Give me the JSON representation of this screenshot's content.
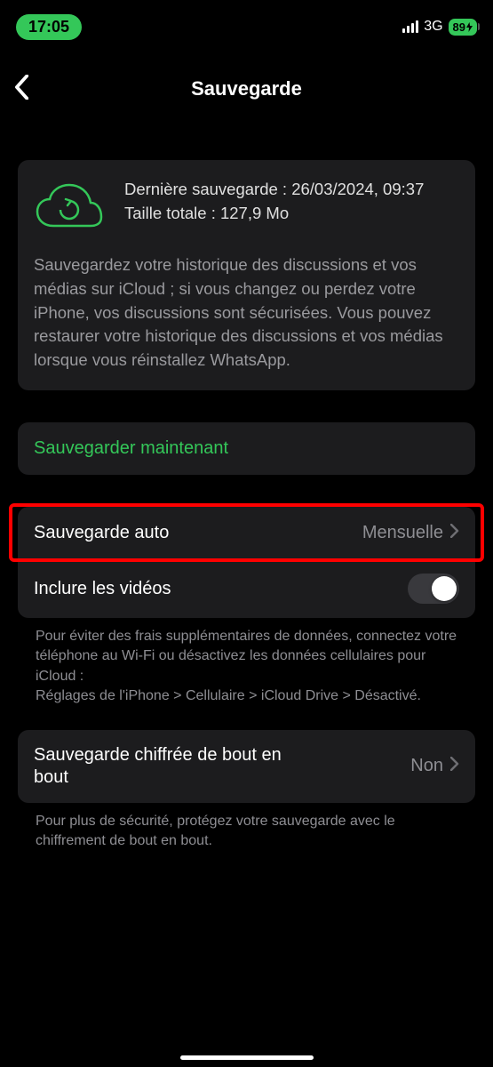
{
  "status": {
    "time": "17:05",
    "network": "3G",
    "battery": "89"
  },
  "header": {
    "title": "Sauvegarde"
  },
  "backup_panel": {
    "last_backup_label": "Dernière sauvegarde : 26/03/2024, 09:37",
    "total_size_label": "Taille totale : 127,9 Mo",
    "description": "Sauvegardez votre historique des discussions et vos médias sur iCloud ; si vous changez ou perdez votre iPhone, vos discussions sont sécurisées. Vous pouvez restaurer votre historique des discussions et vos médias lorsque vous réinstallez WhatsApp."
  },
  "actions": {
    "backup_now": "Sauvegarder maintenant"
  },
  "settings": {
    "auto_backup_label": "Sauvegarde auto",
    "auto_backup_value": "Mensuelle",
    "include_videos_label": "Inclure les vidéos",
    "include_videos_on": false,
    "data_note": "Pour éviter des frais supplémentaires de données, connectez votre téléphone au Wi-Fi ou désactivez les données cellulaires pour iCloud :\nRéglages de l'iPhone > Cellulaire > iCloud Drive > Désactivé.",
    "e2e_label": "Sauvegarde chiffrée de bout en bout",
    "e2e_value": "Non",
    "e2e_note": "Pour plus de sécurité, protégez votre sauvegarde avec le chiffrement de bout en bout."
  },
  "colors": {
    "accent_green": "#34c759",
    "panel_bg": "#1c1c1e",
    "secondary_text": "#8e8e93",
    "highlight": "#ff0000"
  }
}
